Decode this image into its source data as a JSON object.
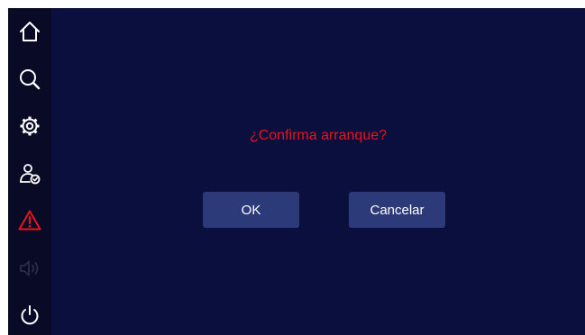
{
  "sidebar": {
    "items": [
      {
        "icon": "home-icon",
        "color": "#ffffff",
        "enabled": true
      },
      {
        "icon": "search-icon",
        "color": "#ffffff",
        "enabled": true
      },
      {
        "icon": "settings-gear-icon",
        "color": "#ffffff",
        "enabled": true
      },
      {
        "icon": "user-check-icon",
        "color": "#ffffff",
        "enabled": true
      },
      {
        "icon": "alarm-warning-icon",
        "color": "#e8141c",
        "enabled": true
      },
      {
        "icon": "volume-muted-icon",
        "color": "#2a2d48",
        "enabled": false
      },
      {
        "icon": "power-icon",
        "color": "#ffffff",
        "enabled": true
      }
    ]
  },
  "dialog": {
    "message": "¿Confirma arranque?",
    "message_color": "#e8141c",
    "ok_label": "OK",
    "cancel_label": "Cancelar"
  },
  "colors": {
    "background": "#0b0f3d",
    "sidebar": "#090b26",
    "button": "#2c3a7a"
  }
}
